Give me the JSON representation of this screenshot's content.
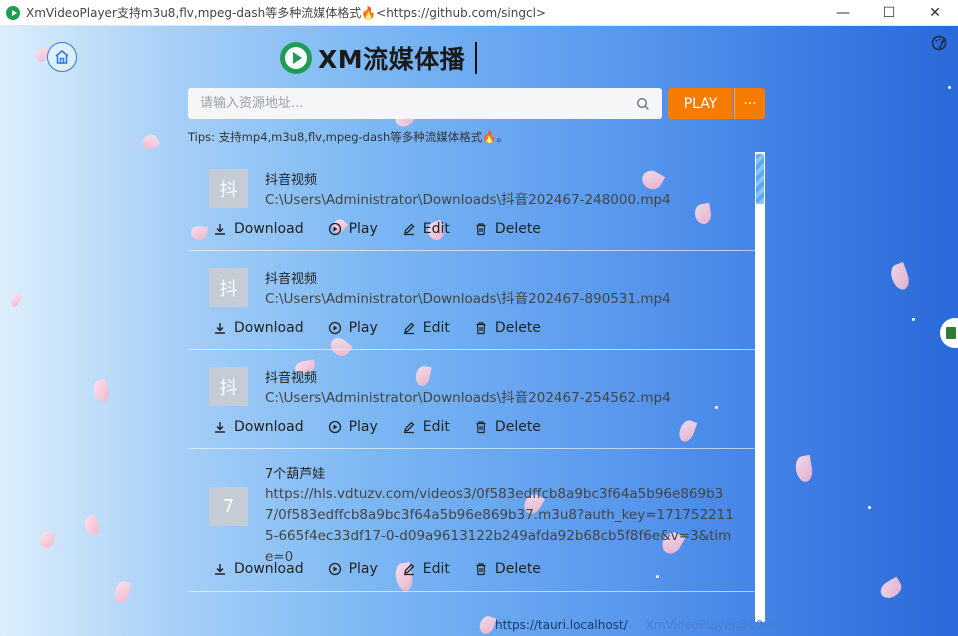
{
  "window": {
    "title": "XmVideoPlayer支持m3u8,flv,mpeg-dash等多种流媒体格式🔥<https://github.com/singcl>",
    "minimize": "—",
    "maximize": "☐",
    "close": "✕"
  },
  "brand": {
    "name": "XM流媒体播"
  },
  "search": {
    "placeholder": "请输入资源地址...",
    "value": ""
  },
  "play_button": "PLAY",
  "more_button": "···",
  "tips": "Tips: 支持mp4,m3u8,flv,mpeg-dash等多种流媒体格式🔥。",
  "actions": {
    "download": "Download",
    "play": "Play",
    "edit": "Edit",
    "delete": "Delete"
  },
  "items": [
    {
      "thumb": "抖",
      "title": "抖音视频",
      "path": "C:\\Users\\Administrator\\Downloads\\抖音202467-248000.mp4"
    },
    {
      "thumb": "抖",
      "title": "抖音视频",
      "path": "C:\\Users\\Administrator\\Downloads\\抖音202467-890531.mp4"
    },
    {
      "thumb": "抖",
      "title": "抖音视频",
      "path": "C:\\Users\\Administrator\\Downloads\\抖音202467-254562.mp4"
    },
    {
      "thumb": "7",
      "title": "7个葫芦娃",
      "path": "https://hls.vdtuzv.com/videos3/0f583edffcb8a9bc3f64a5b96e869b37/0f583edffcb8a9bc3f64a5b96e869b37.m3u8?auth_key=1717522115-665f4ec33df17-0-d09a9613122b249afda92b68cb5f8f6e&v=3&time=0"
    }
  ],
  "status": {
    "url": "https://tauri.localhost/",
    "version": "XmVideoPlayer@v0.6.2"
  },
  "colors": {
    "accent": "#f57c00",
    "brand_green": "#1f9d55",
    "home_blue": "#2c7be5"
  }
}
